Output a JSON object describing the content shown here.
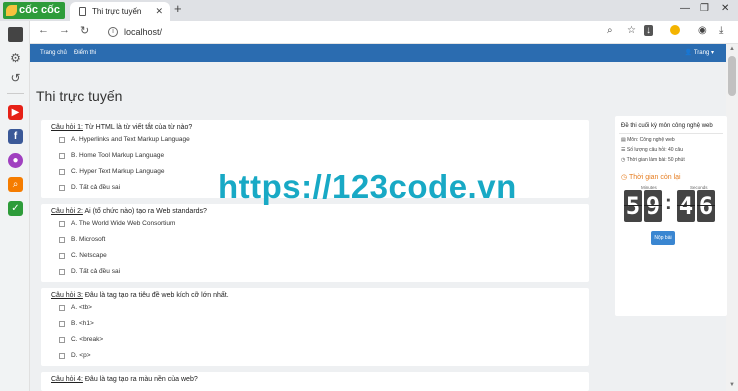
{
  "browser": {
    "logo_text": "cốc cốc",
    "tab_title": "Thi trực tuyến",
    "new_tab_label": "+",
    "url": "localhost/",
    "window_controls": {
      "minimize": "—",
      "restore": "❐",
      "close": "✕"
    }
  },
  "navbar": {
    "links": [
      "Trang chủ",
      "Điểm thi"
    ],
    "user": "Trang"
  },
  "page": {
    "title": "Thi trực tuyến",
    "questions": [
      {
        "number": "Câu hỏi 1:",
        "text": "Từ HTML là từ viết tắt của từ nào?",
        "options": [
          "A. Hyperlinks and Text Markup Language",
          "B. Home Tool Markup Language",
          "C. Hyper Text Markup Language",
          "D. Tất cả đều sai"
        ]
      },
      {
        "number": "Câu hỏi 2:",
        "text": "Ai (tổ chức nào) tạo ra Web standards?",
        "options": [
          "A. The World Wide Web Consortium",
          "B. Microsoft",
          "C. Netscape",
          "D. Tất cả đều sai"
        ]
      },
      {
        "number": "Câu hỏi 3:",
        "text": "Đâu là tag tạo ra tiêu đề web kích cỡ lớn nhất.",
        "options": [
          "A. <tb>",
          "B. <h1>",
          "C. <break>",
          "D. <p>"
        ]
      },
      {
        "number": "Câu hỏi 4:",
        "text": "Đâu là tag tạo ra màu nền của web?",
        "options": []
      }
    ]
  },
  "exam_panel": {
    "title": "Đề thi cuối kỳ môn công nghệ web",
    "subject": "Môn: Công nghệ web",
    "question_count": "Số lượng câu hỏi: 40 câu",
    "duration": "Thời gian làm bài: 50 phút",
    "timer_title": "Thời gian còn lại",
    "minutes_label": "Minutes",
    "seconds_label": "Seconds",
    "minutes": [
      "5",
      "9"
    ],
    "seconds": [
      "4",
      "6"
    ],
    "colon": ":",
    "submit_label": "Nộp bài"
  },
  "watermark": "https://123code.vn"
}
